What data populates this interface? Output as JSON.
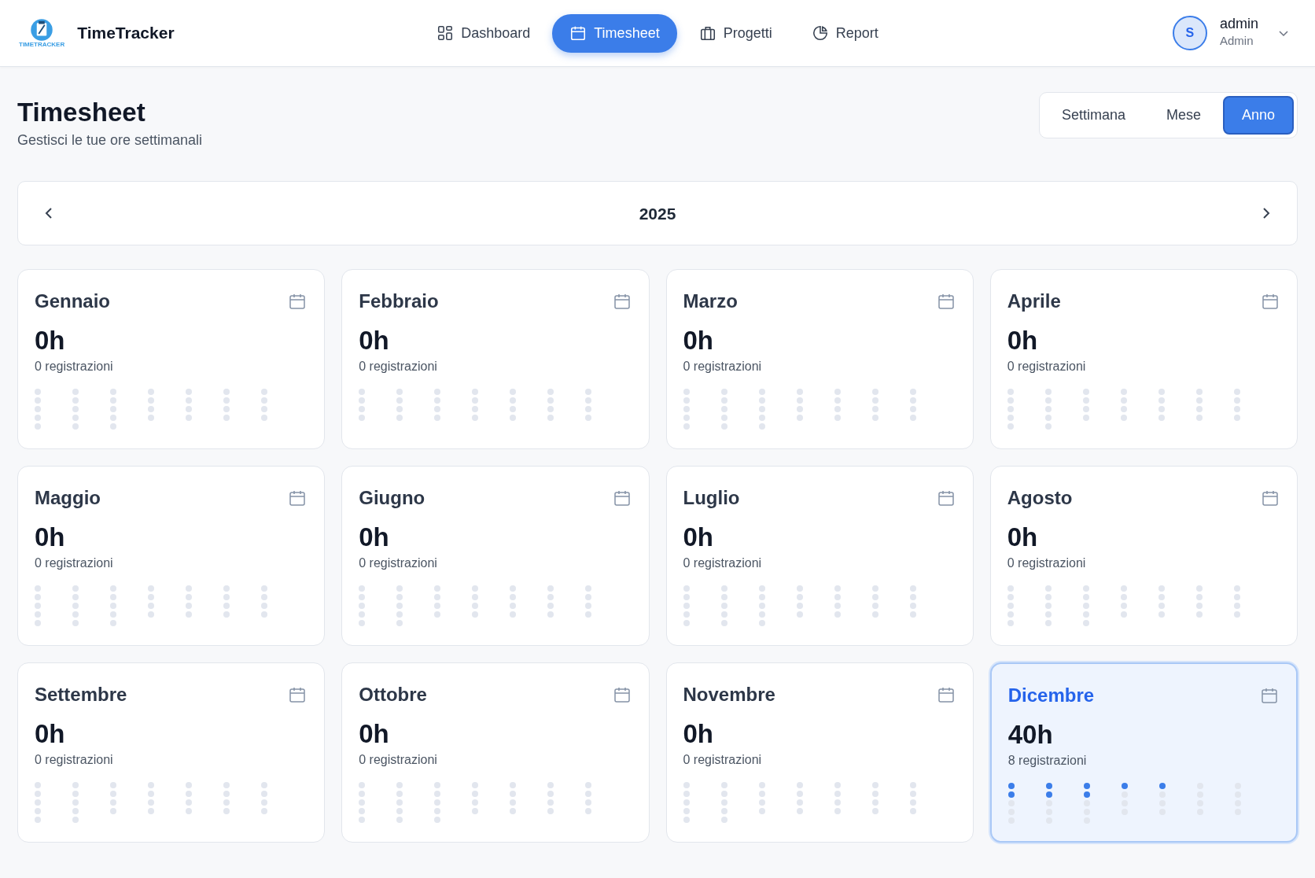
{
  "brand": {
    "name": "TimeTracker",
    "logo_caption": "TIMETRACKER"
  },
  "nav": [
    {
      "label": "Dashboard",
      "selected": false
    },
    {
      "label": "Timesheet",
      "selected": true
    },
    {
      "label": "Progetti",
      "selected": false
    },
    {
      "label": "Report",
      "selected": false
    }
  ],
  "user": {
    "initial": "S",
    "name": "admin",
    "role": "Admin"
  },
  "page": {
    "title": "Timesheet",
    "subtitle": "Gestisci le tue ore settimanali"
  },
  "views": [
    {
      "label": "Settimana",
      "selected": false
    },
    {
      "label": "Mese",
      "selected": false
    },
    {
      "label": "Anno",
      "selected": true
    }
  ],
  "period": {
    "label": "2025"
  },
  "months": [
    {
      "name": "Gennaio",
      "hours": "0h",
      "entries": "0 registrazioni",
      "selected": false,
      "dot_columns": [
        [
          false,
          false,
          false,
          false,
          false
        ],
        [
          false,
          false,
          false,
          false,
          false
        ],
        [
          false,
          false,
          false,
          false,
          false
        ],
        [
          false,
          false,
          false,
          false
        ],
        [
          false,
          false,
          false,
          false
        ],
        [
          false,
          false,
          false,
          false
        ],
        [
          false,
          false,
          false,
          false
        ]
      ]
    },
    {
      "name": "Febbraio",
      "hours": "0h",
      "entries": "0 registrazioni",
      "selected": false,
      "dot_columns": [
        [
          false,
          false,
          false,
          false
        ],
        [
          false,
          false,
          false,
          false
        ],
        [
          false,
          false,
          false,
          false
        ],
        [
          false,
          false,
          false,
          false
        ],
        [
          false,
          false,
          false,
          false
        ],
        [
          false,
          false,
          false,
          false
        ],
        [
          false,
          false,
          false,
          false
        ]
      ]
    },
    {
      "name": "Marzo",
      "hours": "0h",
      "entries": "0 registrazioni",
      "selected": false,
      "dot_columns": [
        [
          false,
          false,
          false,
          false,
          false
        ],
        [
          false,
          false,
          false,
          false,
          false
        ],
        [
          false,
          false,
          false,
          false,
          false
        ],
        [
          false,
          false,
          false,
          false
        ],
        [
          false,
          false,
          false,
          false
        ],
        [
          false,
          false,
          false,
          false
        ],
        [
          false,
          false,
          false,
          false
        ]
      ]
    },
    {
      "name": "Aprile",
      "hours": "0h",
      "entries": "0 registrazioni",
      "selected": false,
      "dot_columns": [
        [
          false,
          false,
          false,
          false,
          false
        ],
        [
          false,
          false,
          false,
          false,
          false
        ],
        [
          false,
          false,
          false,
          false
        ],
        [
          false,
          false,
          false,
          false
        ],
        [
          false,
          false,
          false,
          false
        ],
        [
          false,
          false,
          false,
          false
        ],
        [
          false,
          false,
          false,
          false
        ]
      ]
    },
    {
      "name": "Maggio",
      "hours": "0h",
      "entries": "0 registrazioni",
      "selected": false,
      "dot_columns": [
        [
          false,
          false,
          false,
          false,
          false
        ],
        [
          false,
          false,
          false,
          false,
          false
        ],
        [
          false,
          false,
          false,
          false,
          false
        ],
        [
          false,
          false,
          false,
          false
        ],
        [
          false,
          false,
          false,
          false
        ],
        [
          false,
          false,
          false,
          false
        ],
        [
          false,
          false,
          false,
          false
        ]
      ]
    },
    {
      "name": "Giugno",
      "hours": "0h",
      "entries": "0 registrazioni",
      "selected": false,
      "dot_columns": [
        [
          false,
          false,
          false,
          false,
          false
        ],
        [
          false,
          false,
          false,
          false,
          false
        ],
        [
          false,
          false,
          false,
          false
        ],
        [
          false,
          false,
          false,
          false
        ],
        [
          false,
          false,
          false,
          false
        ],
        [
          false,
          false,
          false,
          false
        ],
        [
          false,
          false,
          false,
          false
        ]
      ]
    },
    {
      "name": "Luglio",
      "hours": "0h",
      "entries": "0 registrazioni",
      "selected": false,
      "dot_columns": [
        [
          false,
          false,
          false,
          false,
          false
        ],
        [
          false,
          false,
          false,
          false,
          false
        ],
        [
          false,
          false,
          false,
          false,
          false
        ],
        [
          false,
          false,
          false,
          false
        ],
        [
          false,
          false,
          false,
          false
        ],
        [
          false,
          false,
          false,
          false
        ],
        [
          false,
          false,
          false,
          false
        ]
      ]
    },
    {
      "name": "Agosto",
      "hours": "0h",
      "entries": "0 registrazioni",
      "selected": false,
      "dot_columns": [
        [
          false,
          false,
          false,
          false,
          false
        ],
        [
          false,
          false,
          false,
          false,
          false
        ],
        [
          false,
          false,
          false,
          false,
          false
        ],
        [
          false,
          false,
          false,
          false
        ],
        [
          false,
          false,
          false,
          false
        ],
        [
          false,
          false,
          false,
          false
        ],
        [
          false,
          false,
          false,
          false
        ]
      ]
    },
    {
      "name": "Settembre",
      "hours": "0h",
      "entries": "0 registrazioni",
      "selected": false,
      "dot_columns": [
        [
          false,
          false,
          false,
          false,
          false
        ],
        [
          false,
          false,
          false,
          false,
          false
        ],
        [
          false,
          false,
          false,
          false
        ],
        [
          false,
          false,
          false,
          false
        ],
        [
          false,
          false,
          false,
          false
        ],
        [
          false,
          false,
          false,
          false
        ],
        [
          false,
          false,
          false,
          false
        ]
      ]
    },
    {
      "name": "Ottobre",
      "hours": "0h",
      "entries": "0 registrazioni",
      "selected": false,
      "dot_columns": [
        [
          false,
          false,
          false,
          false,
          false
        ],
        [
          false,
          false,
          false,
          false,
          false
        ],
        [
          false,
          false,
          false,
          false,
          false
        ],
        [
          false,
          false,
          false,
          false
        ],
        [
          false,
          false,
          false,
          false
        ],
        [
          false,
          false,
          false,
          false
        ],
        [
          false,
          false,
          false,
          false
        ]
      ]
    },
    {
      "name": "Novembre",
      "hours": "0h",
      "entries": "0 registrazioni",
      "selected": false,
      "dot_columns": [
        [
          false,
          false,
          false,
          false,
          false
        ],
        [
          false,
          false,
          false,
          false,
          false
        ],
        [
          false,
          false,
          false,
          false
        ],
        [
          false,
          false,
          false,
          false
        ],
        [
          false,
          false,
          false,
          false
        ],
        [
          false,
          false,
          false,
          false
        ],
        [
          false,
          false,
          false,
          false
        ]
      ]
    },
    {
      "name": "Dicembre",
      "hours": "40h",
      "entries": "8 registrazioni",
      "selected": true,
      "dot_columns": [
        [
          true,
          true,
          false,
          false,
          false
        ],
        [
          true,
          true,
          false,
          false,
          false
        ],
        [
          true,
          true,
          false,
          false,
          false
        ],
        [
          true,
          false,
          false,
          false
        ],
        [
          true,
          false,
          false,
          false
        ],
        [
          false,
          false,
          false,
          false
        ],
        [
          false,
          false,
          false,
          false
        ]
      ]
    }
  ]
}
